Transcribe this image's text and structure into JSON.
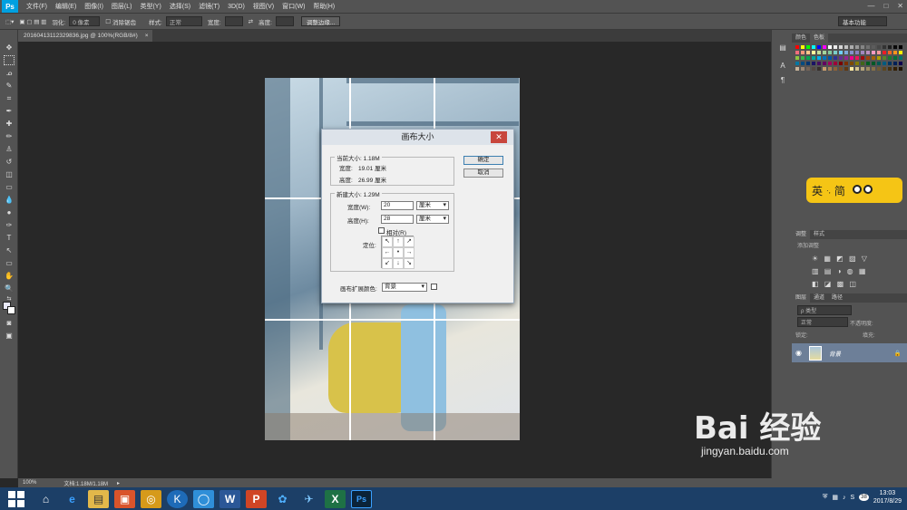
{
  "menubar": {
    "logo": "Ps",
    "items": [
      "文件(F)",
      "编辑(E)",
      "图像(I)",
      "图层(L)",
      "类型(Y)",
      "选择(S)",
      "滤镜(T)",
      "3D(D)",
      "视图(V)",
      "窗口(W)",
      "帮助(H)"
    ],
    "minimize": "—",
    "maximize": "□",
    "close": "✕"
  },
  "options": {
    "feather_label": "羽化:",
    "feather_value": "0 像素",
    "antialias_label": "消除锯齿",
    "style_label": "样式:",
    "style_value": "正常",
    "width_label": "宽度:",
    "height_label": "高度:",
    "refine_edge": "调整边缘...",
    "workspace": "基本功能"
  },
  "document": {
    "tab_title": "20160413112329836.jpg @ 100%(RGB/8#)",
    "tab_close": "×"
  },
  "dialog": {
    "title": "画布大小",
    "close": "✕",
    "current_size_legend": "当前大小: 1.18M",
    "current_width_label": "宽度:",
    "current_width_value": "19.01 厘米",
    "current_height_label": "高度:",
    "current_height_value": "26.99 厘米",
    "new_size_legend": "新建大小: 1.29M",
    "width_label": "宽度(W):",
    "width_value": "20",
    "width_unit": "厘米",
    "height_label": "高度(H):",
    "height_value": "28",
    "height_unit": "厘米",
    "relative_label": "相对(R)",
    "anchor_label": "定位:",
    "anchor": [
      "↖",
      "↑",
      "↗",
      "←",
      "•",
      "→",
      "↙",
      "↓",
      "↘"
    ],
    "extension_color_label": "画布扩展颜色:",
    "extension_color_value": "背景",
    "ok_button": "确定",
    "cancel_button": "取消"
  },
  "right_panel": {
    "swatch_tabs": [
      "颜色",
      "色板"
    ],
    "adjustment_tabs": [
      "调整",
      "样式"
    ],
    "adjustment_hint": "添加调整",
    "layer_tabs": [
      "图层",
      "通道",
      "路径"
    ],
    "kind_label": "ρ 类型",
    "blend_mode": "正常",
    "opacity_label": "不透明度:",
    "lock_label": "锁定:",
    "fill_label": "填充:",
    "layer_name": "背景"
  },
  "statusbar": {
    "zoom": "100%",
    "doc_size": "文档:1.18M/1.18M"
  },
  "ime": {
    "label1": "英",
    "separator": "·,",
    "label2": "简"
  },
  "taskbar": {
    "apps": [
      "⌂",
      "e",
      "▤",
      "▣",
      "◎",
      "K",
      "◯",
      "W",
      "P",
      "✿",
      "✈",
      "X",
      "Ps"
    ],
    "clock_time": "13:03",
    "clock_date": "2017/8/29",
    "tray_badge": "38"
  },
  "watermark": {
    "logo": "Bai 经验",
    "url": "jingyan.baidu.com"
  },
  "colors": {
    "accent": "#00a0e0",
    "close_red": "#c8463c",
    "taskbar": "#1c3f67",
    "ime_yellow": "#f5c515",
    "selected_layer": "#6d7f98"
  }
}
